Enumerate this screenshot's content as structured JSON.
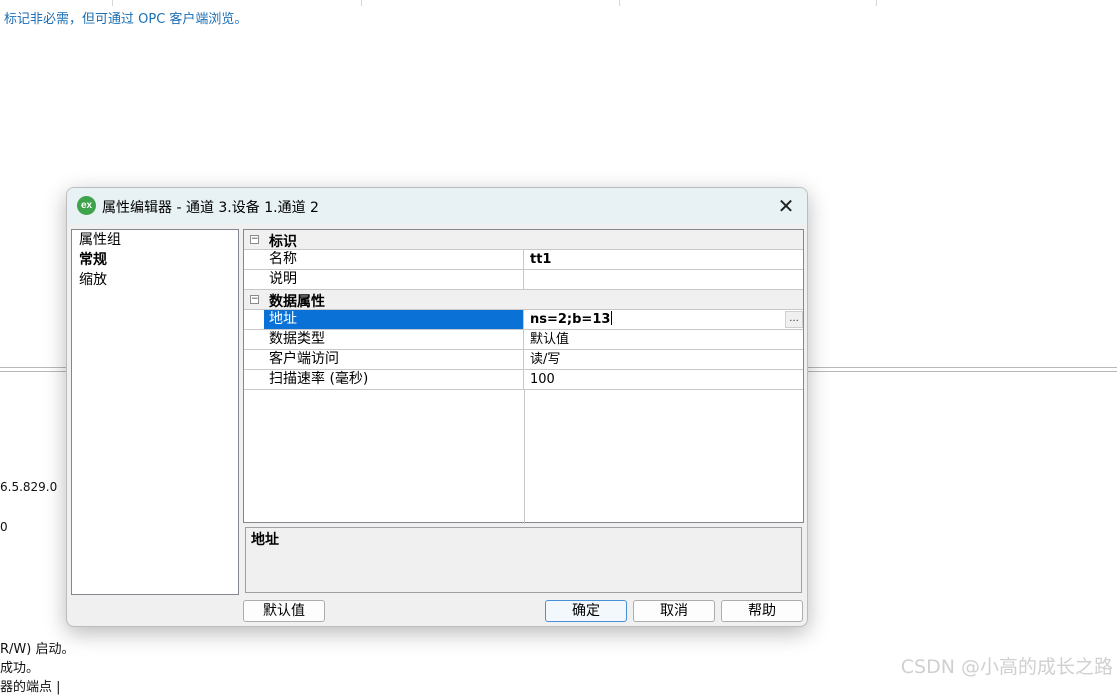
{
  "background": {
    "hint_text": "标记非必需，但可通过 OPC 客户端浏览。",
    "log_lines": [
      "6.5.829.0",
      "0",
      "R/W) 启动。",
      "成功。",
      "器的端点 |"
    ],
    "watermark": "CSDN @小高的成长之路"
  },
  "dialog": {
    "logo_text": "ex",
    "title": "属性编辑器 - 通道 3.设备 1.通道 2",
    "close_glyph": "✕",
    "groups": {
      "header": "属性组",
      "items": [
        "常规",
        "缩放"
      ]
    },
    "categories": {
      "identity": {
        "label": "标识",
        "toggle": "−",
        "name_label": "名称",
        "name_value": "tt1",
        "desc_label": "说明",
        "desc_value": ""
      },
      "data": {
        "label": "数据属性",
        "toggle": "−",
        "address_label": "地址",
        "address_value": "ns=2;b=13",
        "address_btn": "...",
        "datatype_label": "数据类型",
        "datatype_value": "默认值",
        "access_label": "客户端访问",
        "access_value": "读/写",
        "scanrate_label": "扫描速率 (毫秒)",
        "scanrate_value": "100"
      }
    },
    "description_title": "地址",
    "buttons": {
      "defaults": "默认值",
      "ok": "确定",
      "cancel": "取消",
      "help": "帮助"
    }
  },
  "colors": {
    "selection": "#0a72d6",
    "hint_text": "#1b6fb5",
    "logo": "#3ea34a"
  }
}
